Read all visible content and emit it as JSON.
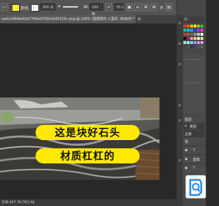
{
  "options_bar": {
    "foreground_color": "#f5f03a",
    "blend_label": "颜色",
    "size_value": "200 点",
    "w_label": "W:",
    "w_value": "100 像",
    "h_value": "55.1",
    "blend_mode": "常规",
    "opacity_label": "不",
    "chevron": "▾"
  },
  "document": {
    "tab_title": "ead1c684be42d7745e0709c93d5153c.png @ 100% (圆角矩形 2 副本, RGB/8) *",
    "close": "×"
  },
  "canvas": {
    "caption_line1": "这是块好石头",
    "caption_line2": "材质杠杠的",
    "caption_color": "#ffe900"
  },
  "status_bar": {
    "doc_size": "文档:457.7K/762.0K"
  },
  "panels": {
    "layers_tab": "图层",
    "kind_label": "类型",
    "normal_label": "正常",
    "lock_label": "锁",
    "layer_icon": "T",
    "layer_name": "圆角"
  },
  "swatch_colors": [
    "#e33",
    "#f60",
    "#fc0",
    "#ff0",
    "#9c3",
    "#3c3",
    "#0c9",
    "#0cf",
    "#39f",
    "#33f",
    "#93f",
    "#f3c",
    "#c33",
    "#963",
    "#666",
    "#999",
    "#ccc",
    "#fff",
    "#000",
    "#c06",
    "#f99",
    "#fc9",
    "#ff9",
    "#cf9",
    "#9fc",
    "#9ff",
    "#9cf",
    "#99f",
    "#c9f",
    "#f9f",
    "#633",
    "#363",
    "#336",
    "#636",
    "#366",
    "#663"
  ]
}
